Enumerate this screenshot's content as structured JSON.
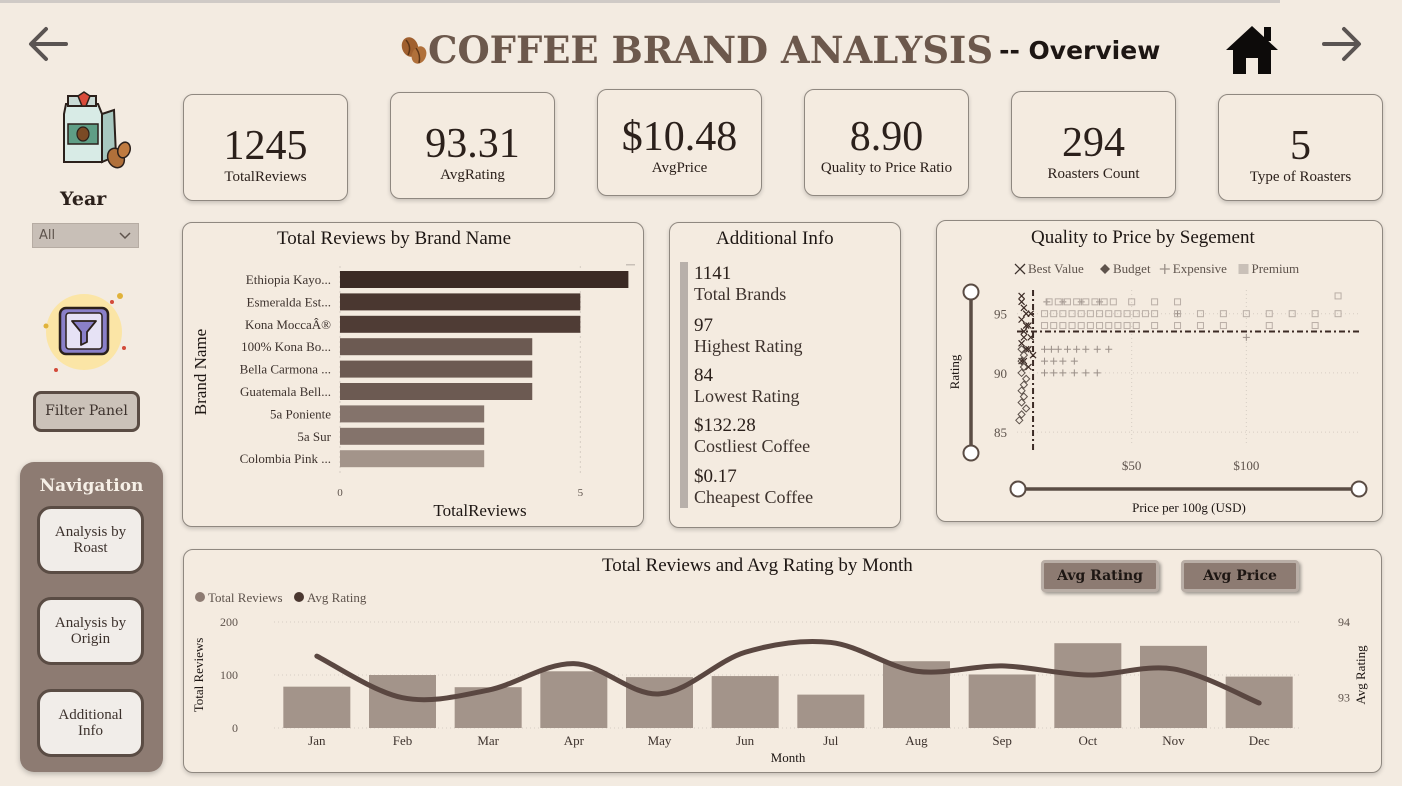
{
  "header": {
    "title": "COFFEE BRAND ANALYSIS",
    "subtitle": "-- Overview",
    "icons": {
      "back": "arrow-left-icon",
      "forward": "arrow-right-icon",
      "home": "home-icon",
      "brand": "coffee-beans-icon"
    }
  },
  "colors": {
    "background": "#f3ebe1",
    "accent": "#6c584c",
    "dark": "#3b2a24",
    "panel": "#8d7b72",
    "bar": "#a3948a"
  },
  "kpis": [
    {
      "value": "1245",
      "label": "TotalReviews"
    },
    {
      "value": "93.31",
      "label": "AvgRating"
    },
    {
      "value": "$10.48",
      "label": "AvgPrice"
    },
    {
      "value": "8.90",
      "label": "Quality to Price Ratio"
    },
    {
      "value": "294",
      "label": "Roasters Count"
    },
    {
      "value": "5",
      "label": "Type of Roasters"
    }
  ],
  "sidebar": {
    "year_label": "Year",
    "year_value": "All",
    "filter_button": "Filter Panel",
    "navigation_title": "Navigation",
    "nav_buttons": [
      "Analysis by Roast",
      "Analysis by Origin",
      "Additional Info"
    ]
  },
  "additional_info": {
    "title": "Additional Info",
    "items": [
      {
        "value": "1141",
        "label": "Total Brands"
      },
      {
        "value": "97",
        "label": "Highest Rating"
      },
      {
        "value": "84",
        "label": "Lowest Rating"
      },
      {
        "value": "$132.28",
        "label": "Costliest Coffee"
      },
      {
        "value": "$0.17",
        "label": "Cheapest Coffee"
      }
    ]
  },
  "toggles": {
    "avg_rating": "Avg Rating",
    "avg_price": "Avg Price"
  },
  "chart_data": [
    {
      "type": "bar",
      "orientation": "horizontal",
      "title": "Total Reviews by Brand Name",
      "xlabel": "TotalReviews",
      "ylabel": "Brand Name",
      "categories": [
        "Ethiopia Kayo...",
        "Esmeralda Est...",
        "Kona MoccaÂ®",
        "100% Kona Bo...",
        "Bella Carmona ...",
        "Guatemala Bell...",
        "5a Poniente",
        "5a Sur",
        "Colombia Pink ..."
      ],
      "values": [
        6,
        5,
        5,
        4,
        4,
        4,
        3,
        3,
        3
      ],
      "xticks": [
        0,
        5
      ],
      "xlim": [
        0,
        6.2
      ],
      "colors": [
        "#3b2a24",
        "#4a3730",
        "#4f3c35",
        "#6c5a52",
        "#6c5a52",
        "#6c5a52",
        "#84736b",
        "#84736b",
        "#a3948a"
      ]
    },
    {
      "type": "scatter",
      "title": "Quality to Price by Segement",
      "xlabel": "Price per 100g (USD)",
      "ylabel": "Rating",
      "xticks": [
        "$50",
        "$100"
      ],
      "yticks": [
        85,
        90,
        95
      ],
      "xlim": [
        0,
        150
      ],
      "ylim": [
        84,
        97
      ],
      "reference_lines": {
        "x": 7,
        "y": 93.5
      },
      "legend": [
        "Best Value",
        "Budget",
        "Expensive",
        "Premium"
      ],
      "legend_position": "top",
      "series": [
        {
          "name": "Best Value",
          "marker": "x",
          "points": [
            [
              2,
              96
            ],
            [
              3,
              95.5
            ],
            [
              4,
              95
            ],
            [
              2,
              94.5
            ],
            [
              5,
              94
            ],
            [
              3,
              93.5
            ],
            [
              6,
              93
            ],
            [
              2,
              92.5
            ],
            [
              4,
              92
            ],
            [
              7,
              91.5
            ],
            [
              3,
              91
            ],
            [
              5,
              90.5
            ],
            [
              2,
              96.5
            ],
            [
              6,
              95
            ],
            [
              4,
              94
            ],
            [
              3,
              93
            ],
            [
              5,
              92
            ],
            [
              2,
              91
            ]
          ]
        },
        {
          "name": "Budget",
          "marker": "diamond",
          "points": [
            [
              2,
              91
            ],
            [
              3,
              90.5
            ],
            [
              2,
              90
            ],
            [
              4,
              89.5
            ],
            [
              3,
              89
            ],
            [
              2,
              88.5
            ],
            [
              3,
              88
            ],
            [
              2,
              87.5
            ],
            [
              4,
              87
            ],
            [
              2,
              86.5
            ],
            [
              1,
              86
            ],
            [
              3,
              91.5
            ],
            [
              2,
              92
            ]
          ]
        },
        {
          "name": "Expensive",
          "marker": "plus",
          "points": [
            [
              12,
              92
            ],
            [
              15,
              92
            ],
            [
              18,
              92
            ],
            [
              22,
              92
            ],
            [
              26,
              92
            ],
            [
              30,
              92
            ],
            [
              35,
              92
            ],
            [
              40,
              92
            ],
            [
              12,
              91
            ],
            [
              16,
              91
            ],
            [
              20,
              91
            ],
            [
              25,
              91
            ],
            [
              12,
              90
            ],
            [
              16,
              90
            ],
            [
              20,
              90
            ],
            [
              25,
              90
            ],
            [
              30,
              90
            ],
            [
              35,
              90
            ],
            [
              13,
              96
            ],
            [
              20,
              96
            ],
            [
              28,
              96
            ],
            [
              36,
              96
            ],
            [
              70,
              95
            ],
            [
              100,
              93
            ]
          ]
        },
        {
          "name": "Premium",
          "marker": "square",
          "points": [
            [
              12,
              95
            ],
            [
              16,
              95
            ],
            [
              20,
              95
            ],
            [
              24,
              95
            ],
            [
              28,
              95
            ],
            [
              32,
              95
            ],
            [
              36,
              95
            ],
            [
              40,
              95
            ],
            [
              44,
              95
            ],
            [
              48,
              95
            ],
            [
              52,
              95
            ],
            [
              56,
              95
            ],
            [
              60,
              95
            ],
            [
              70,
              95
            ],
            [
              80,
              95
            ],
            [
              90,
              95
            ],
            [
              100,
              95
            ],
            [
              110,
              95
            ],
            [
              120,
              95
            ],
            [
              130,
              95
            ],
            [
              140,
              95
            ],
            [
              12,
              94
            ],
            [
              16,
              94
            ],
            [
              20,
              94
            ],
            [
              24,
              94
            ],
            [
              28,
              94
            ],
            [
              32,
              94
            ],
            [
              36,
              94
            ],
            [
              40,
              94
            ],
            [
              44,
              94
            ],
            [
              48,
              94
            ],
            [
              52,
              94
            ],
            [
              60,
              94
            ],
            [
              70,
              94
            ],
            [
              80,
              94
            ],
            [
              90,
              94
            ],
            [
              110,
              94
            ],
            [
              130,
              94
            ],
            [
              14,
              96
            ],
            [
              18,
              96
            ],
            [
              22,
              96
            ],
            [
              26,
              96
            ],
            [
              30,
              96
            ],
            [
              34,
              96
            ],
            [
              38,
              96
            ],
            [
              42,
              96
            ],
            [
              50,
              96
            ],
            [
              60,
              96
            ],
            [
              70,
              96
            ],
            [
              140,
              96.5
            ]
          ]
        }
      ]
    },
    {
      "type": "bar",
      "title": "Total Reviews and Avg Rating by Month",
      "xlabel": "Month",
      "ylabel": "Total Reviews",
      "y2label": "Avg Rating",
      "categories": [
        "Jan",
        "Feb",
        "Mar",
        "Apr",
        "May",
        "Jun",
        "Jul",
        "Aug",
        "Sep",
        "Oct",
        "Nov",
        "Dec"
      ],
      "legend": [
        "Total Reviews",
        "Avg Rating"
      ],
      "legend_position": "top-left",
      "ylim": [
        0,
        200
      ],
      "yticks": [
        0,
        100,
        200
      ],
      "y2lim": [
        92.6,
        94.0
      ],
      "y2ticks": [
        93,
        94
      ],
      "series": [
        {
          "name": "Total Reviews",
          "type": "bar",
          "values": [
            78,
            100,
            77,
            107,
            96,
            98,
            63,
            126,
            101,
            160,
            155,
            97
          ]
        },
        {
          "name": "Avg Rating",
          "type": "line",
          "values": [
            93.55,
            93.0,
            93.1,
            93.45,
            93.05,
            93.6,
            93.73,
            93.35,
            93.42,
            93.3,
            93.38,
            92.93
          ]
        }
      ]
    }
  ]
}
